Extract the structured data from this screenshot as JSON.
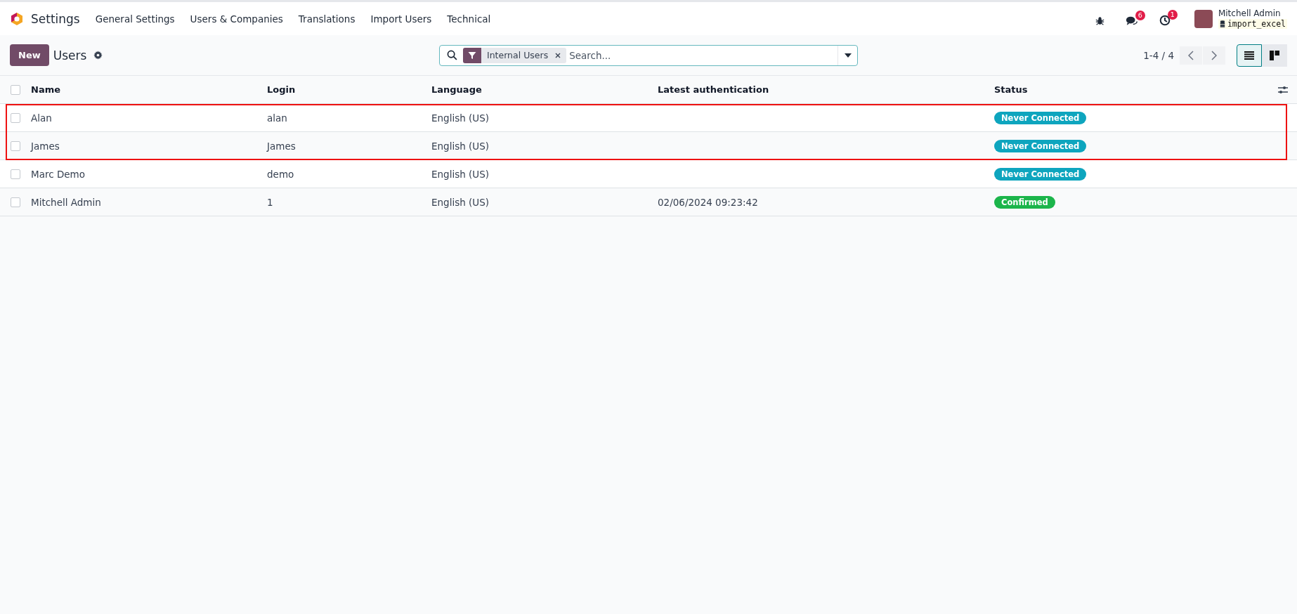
{
  "navbar": {
    "app_name": "Settings",
    "menu": [
      "General Settings",
      "Users & Companies",
      "Translations",
      "Import Users",
      "Technical"
    ],
    "messages_badge": "6",
    "activities_badge": "1",
    "user": {
      "name": "Mitchell Admin",
      "database": "import_excel"
    }
  },
  "control_panel": {
    "new_button": "New",
    "title": "Users",
    "search": {
      "facet": "Internal Users",
      "placeholder": "Search..."
    },
    "pager": "1-4 / 4",
    "views": [
      {
        "kind": "list",
        "selected": true
      },
      {
        "kind": "kanban",
        "selected": false
      }
    ]
  },
  "table": {
    "select_all": {
      "checked": false
    },
    "columns": [
      "Name",
      "Login",
      "Language",
      "Latest authentication",
      "Status"
    ],
    "rows": [
      {
        "checked": false,
        "highlighted": true,
        "name": "Alan",
        "login": "alan",
        "language": "English (US)",
        "latest_authentication": "",
        "status": {
          "label": "Never Connected",
          "color": "#0ea5be"
        }
      },
      {
        "checked": false,
        "highlighted": true,
        "name": "James",
        "login": "James",
        "language": "English (US)",
        "latest_authentication": "",
        "status": {
          "label": "Never Connected",
          "color": "#0ea5be"
        }
      },
      {
        "checked": false,
        "highlighted": false,
        "name": "Marc Demo",
        "login": "demo",
        "language": "English (US)",
        "latest_authentication": "",
        "status": {
          "label": "Never Connected",
          "color": "#0ea5be"
        }
      },
      {
        "checked": false,
        "highlighted": false,
        "name": "Mitchell Admin",
        "login": "1",
        "language": "English (US)",
        "latest_authentication": "02/06/2024 09:23:42",
        "status": {
          "label": "Confirmed",
          "color": "#1cb54b"
        }
      }
    ]
  }
}
